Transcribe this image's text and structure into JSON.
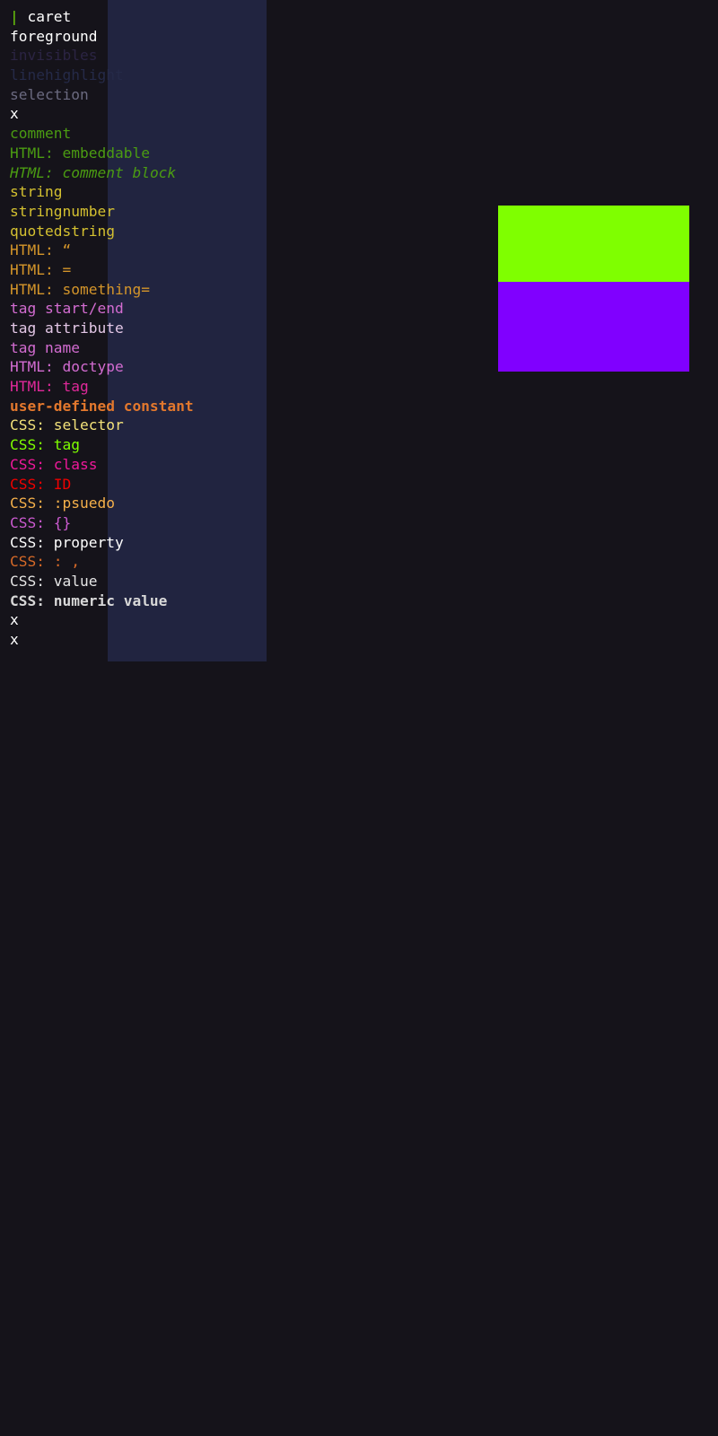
{
  "colors": {
    "background": "#15131a",
    "linehighlight_panel": "#212440",
    "swatch_top": "#7fff00",
    "swatch_bottom": "#8000ff"
  },
  "caret": {
    "glyph": "|",
    "glyph_color": "#6fd10a"
  },
  "lines": [
    {
      "prefix": "",
      "text": "caret",
      "color": "#ffffff",
      "prefix_color": "",
      "style": ""
    },
    {
      "prefix": "",
      "text": "foreground",
      "color": "#ffffff",
      "prefix_color": "",
      "style": ""
    },
    {
      "prefix": "",
      "text": "invisibles",
      "color": "#2b2443",
      "prefix_color": "",
      "style": ""
    },
    {
      "prefix": "",
      "text": "linehighlight",
      "color": "#252a48",
      "prefix_color": "",
      "style": ""
    },
    {
      "prefix": "",
      "text": "selection",
      "color": "#6b6a80",
      "prefix_color": "",
      "style": ""
    },
    {
      "prefix": "",
      "text": "x",
      "color": "#ffffff",
      "prefix_color": "",
      "style": ""
    },
    {
      "prefix": "",
      "text": "comment",
      "color": "#4b9c12",
      "prefix_color": "",
      "style": ""
    },
    {
      "prefix": "HTML: ",
      "text": "embeddable",
      "color": "#4b9c12",
      "prefix_color": "#4b9c12",
      "style": ""
    },
    {
      "prefix": "HTML: ",
      "text": "comment block",
      "color": "#4b9c12",
      "prefix_color": "#4b9c12",
      "style": "i"
    },
    {
      "prefix": "",
      "text": "string",
      "color": "#d4c030",
      "prefix_color": "",
      "style": ""
    },
    {
      "prefix": "",
      "text": "stringnumber",
      "color": "#d4c030",
      "prefix_color": "",
      "style": ""
    },
    {
      "prefix": "",
      "text": "quotedstring",
      "color": "#d4c030",
      "prefix_color": "",
      "style": ""
    },
    {
      "prefix": "HTML: ",
      "text": "“",
      "color": "#d4952a",
      "prefix_color": "#d4952a",
      "style": ""
    },
    {
      "prefix": "HTML: ",
      "text": "=",
      "color": "#d4952a",
      "prefix_color": "#d4952a",
      "style": ""
    },
    {
      "prefix": "HTML: ",
      "text": "something=",
      "color": "#d4952a",
      "prefix_color": "#d4952a",
      "style": ""
    },
    {
      "prefix": "",
      "text": "tag start/end",
      "color": "#d36cd1",
      "prefix_color": "",
      "style": ""
    },
    {
      "prefix": "",
      "text": "tag attribute",
      "color": "#e3c7e6",
      "prefix_color": "",
      "style": ""
    },
    {
      "prefix": "",
      "text": "tag name",
      "color": "#d36cd1",
      "prefix_color": "",
      "style": ""
    },
    {
      "prefix": "HTML: ",
      "text": "doctype",
      "color": "#d36cd1",
      "prefix_color": "#d36cd1",
      "style": ""
    },
    {
      "prefix": "HTML: ",
      "text": "tag",
      "color": "#e0299a",
      "prefix_color": "#e0299a",
      "style": ""
    },
    {
      "prefix": "",
      "text": "user-defined constant",
      "color": "#e3782d",
      "prefix_color": "",
      "style": "b"
    },
    {
      "prefix": "CSS: ",
      "text": "selector",
      "color": "#f3e27a",
      "prefix_color": "#f3e27a",
      "style": ""
    },
    {
      "prefix": "CSS: ",
      "text": "tag",
      "color": "#7fff00",
      "prefix_color": "#7fff00",
      "style": ""
    },
    {
      "prefix": "CSS: ",
      "text": "class",
      "color": "#f0189a",
      "prefix_color": "#f0189a",
      "style": ""
    },
    {
      "prefix": "CSS: ",
      "text": "ID",
      "color": "#f00000",
      "prefix_color": "#f00000",
      "style": ""
    },
    {
      "prefix": "CSS: ",
      "text": ":psuedo",
      "color": "#f5b04a",
      "prefix_color": "#f5b04a",
      "style": ""
    },
    {
      "prefix": "CSS: ",
      "text": "{}",
      "color": "#cb5ad0",
      "prefix_color": "#cb5ad0",
      "style": ""
    },
    {
      "prefix": "CSS: ",
      "text": "property",
      "color": "#ffffff",
      "prefix_color": "#ffffff",
      "style": ""
    },
    {
      "prefix": "CSS: ",
      "text": ": ,",
      "color": "#d86a28",
      "prefix_color": "#d86a28",
      "style": ""
    },
    {
      "prefix": "CSS: ",
      "text": "value",
      "color": "#e6e6e6",
      "prefix_color": "#e6e6e6",
      "style": ""
    },
    {
      "prefix": "CSS: ",
      "text": "numeric value",
      "color": "#d8d8d8",
      "prefix_color": "#d8d8d8",
      "style": "b"
    },
    {
      "prefix": "",
      "text": "x",
      "color": "#ffffff",
      "prefix_color": "",
      "style": ""
    },
    {
      "prefix": "",
      "text": "x",
      "color": "#ffffff",
      "prefix_color": "",
      "style": ""
    }
  ]
}
